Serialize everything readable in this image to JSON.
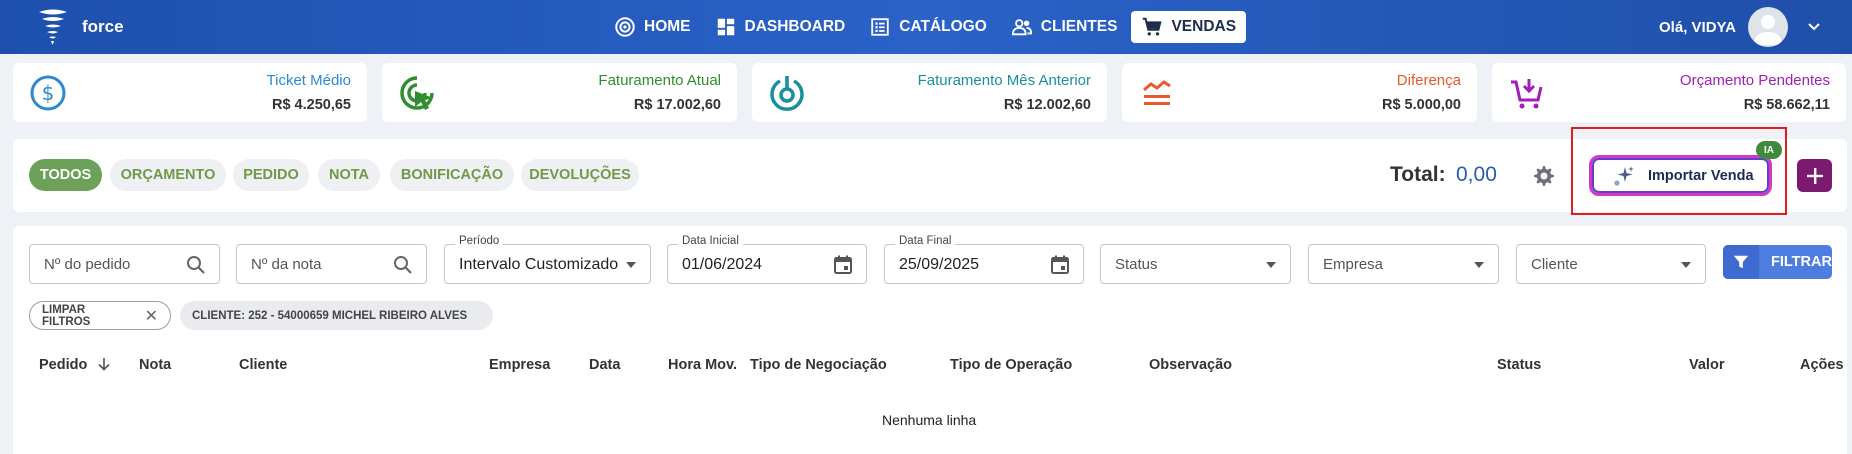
{
  "app": {
    "brand": "force",
    "greeting": "Olá, VIDYA"
  },
  "nav": [
    {
      "label": "HOME",
      "icon": "target-icon"
    },
    {
      "label": "DASHBOARD",
      "icon": "grid-icon"
    },
    {
      "label": "CATÁLOGO",
      "icon": "catalog-icon"
    },
    {
      "label": "CLIENTES",
      "icon": "people-icon"
    },
    {
      "label": "VENDAS",
      "icon": "cart-icon",
      "active": true
    }
  ],
  "kpis": [
    {
      "title": "Ticket Médio",
      "value": "R$ 4.250,65",
      "color": "#2a8ad6"
    },
    {
      "title": "Faturamento Atual",
      "value": "R$ 17.002,60",
      "color": "#2f8f2f"
    },
    {
      "title": "Faturamento Mês Anterior",
      "value": "R$ 12.002,60",
      "color": "#1a8f9e"
    },
    {
      "title": "Diferença",
      "value": "R$ 5.000,00",
      "color": "#e8592b"
    },
    {
      "title": "Orçamento Pendentes",
      "value": "R$ 58.662,11",
      "color": "#a11fb8"
    }
  ],
  "tabs": [
    "TODOS",
    "ORÇAMENTO",
    "PEDIDO",
    "NOTA",
    "BONIFICAÇÃO",
    "DEVOLUÇÕES"
  ],
  "total": {
    "label": "Total:",
    "value": "0,00"
  },
  "import_button": {
    "label": "Importar Venda",
    "badge": "IA"
  },
  "filters": {
    "pedido_placeholder": "Nº do pedido",
    "nota_placeholder": "Nº da nota",
    "periodo_label": "Período",
    "periodo_value": "Intervalo Customizado",
    "data_inicial_label": "Data Inicial",
    "data_inicial_value": "01/06/2024",
    "data_final_label": "Data Final",
    "data_final_value": "25/09/2025",
    "status_placeholder": "Status",
    "empresa_placeholder": "Empresa",
    "cliente_placeholder": "Cliente",
    "filter_button": "FILTRAR"
  },
  "active_filters": {
    "clear": "LIMPAR FILTROS",
    "client": "CLIENTE: 252 - 54000659 MICHEL RIBEIRO ALVES"
  },
  "table": {
    "columns": [
      "Pedido",
      "Nota",
      "Cliente",
      "Empresa",
      "Data",
      "Hora Mov.",
      "Tipo de Negociação",
      "Tipo de Operação",
      "Observação",
      "Status",
      "Valor",
      "Ações"
    ],
    "empty": "Nenhuma linha"
  },
  "colors": {
    "topbar": "#2459bd",
    "accent_green": "#6ba158",
    "plus_button": "#7c1a6e",
    "filter_button": "#4e7de0"
  }
}
